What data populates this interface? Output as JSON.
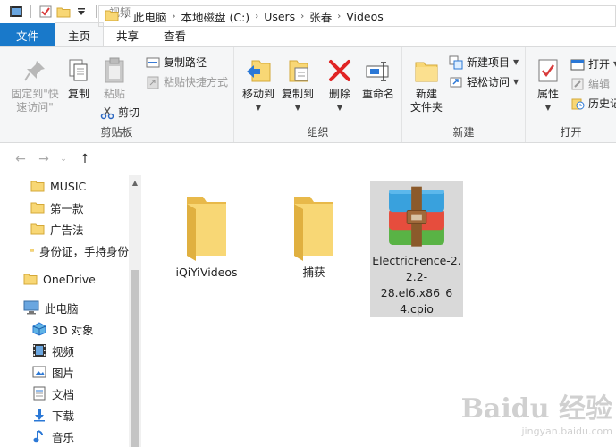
{
  "window": {
    "title": "视频"
  },
  "tabs": [
    {
      "label": "文件"
    },
    {
      "label": "主页"
    },
    {
      "label": "共享"
    },
    {
      "label": "查看"
    }
  ],
  "ribbon": {
    "clipboard": {
      "label": "剪贴板",
      "pin_line1": "固定到\"快",
      "pin_line2": "速访问\"",
      "copy": "复制",
      "paste": "粘贴",
      "copy_path": "复制路径",
      "paste_shortcut": "粘贴快捷方式",
      "cut": "剪切"
    },
    "organize": {
      "label": "组织",
      "move_to": "移动到",
      "copy_to": "复制到",
      "delete": "删除",
      "rename": "重命名"
    },
    "new": {
      "label": "新建",
      "new_folder_line1": "新建",
      "new_folder_line2": "文件夹",
      "new_item": "新建项目",
      "easy_access": "轻松访问"
    },
    "open": {
      "label": "打开",
      "properties": "属性",
      "open": "打开",
      "edit": "编辑",
      "history": "历史记"
    }
  },
  "address": {
    "crumbs": [
      "此电脑",
      "本地磁盘 (C:)",
      "Users",
      "张春",
      "Videos"
    ]
  },
  "navpane": {
    "items": [
      {
        "label": "MUSIC",
        "icon": "folder-icon"
      },
      {
        "label": "第一款",
        "icon": "folder-icon"
      },
      {
        "label": "广告法",
        "icon": "folder-icon"
      },
      {
        "label": "身份证，手持身份",
        "icon": "folder-icon"
      },
      {
        "label": "OneDrive",
        "icon": "folder-icon"
      },
      {
        "label": "此电脑",
        "icon": "computer-icon"
      },
      {
        "label": "3D 对象",
        "icon": "cube-icon"
      },
      {
        "label": "视频",
        "icon": "video-icon"
      },
      {
        "label": "图片",
        "icon": "picture-icon"
      },
      {
        "label": "文档",
        "icon": "document-icon"
      },
      {
        "label": "下载",
        "icon": "download-icon"
      },
      {
        "label": "音乐",
        "icon": "music-icon"
      }
    ]
  },
  "files": [
    {
      "name": "iQiYiVideos",
      "type": "folder"
    },
    {
      "name": "捕获",
      "type": "folder"
    },
    {
      "name_line1": "ElectricFence-2.",
      "name_line2": "2.2-28.el6.x86_6",
      "name_line3": "4.cpio",
      "type": "archive"
    }
  ],
  "watermark": {
    "line1": "Baidu 经验",
    "line2": "jingyan.baidu.com"
  },
  "colors": {
    "file_tab": "#1979ca",
    "folder": "#f8d775",
    "selected": "#d9d9d9"
  }
}
